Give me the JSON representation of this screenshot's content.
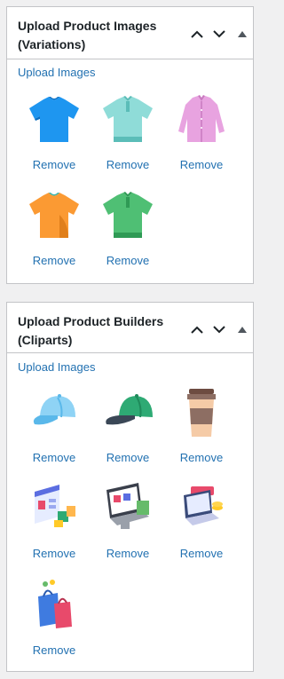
{
  "panels": [
    {
      "title": "Upload Product Images (Variations)",
      "upload_label": "Upload Images",
      "items": [
        {
          "icon": "blue-tshirt-icon",
          "remove_label": "Remove"
        },
        {
          "icon": "teal-polo-shirt-icon",
          "remove_label": "Remove"
        },
        {
          "icon": "pink-dress-shirt-icon",
          "remove_label": "Remove"
        },
        {
          "icon": "orange-tshirt-icon",
          "remove_label": "Remove"
        },
        {
          "icon": "green-polo-shirt-icon",
          "remove_label": "Remove"
        }
      ]
    },
    {
      "title": "Upload Product Builders (Cliparts)",
      "upload_label": "Upload Images",
      "items": [
        {
          "icon": "blue-cap-icon",
          "remove_label": "Remove"
        },
        {
          "icon": "green-cap-icon",
          "remove_label": "Remove"
        },
        {
          "icon": "coffee-cup-icon",
          "remove_label": "Remove"
        },
        {
          "icon": "online-store-isometric-icon",
          "remove_label": "Remove"
        },
        {
          "icon": "ecommerce-laptop-icon",
          "remove_label": "Remove"
        },
        {
          "icon": "online-payment-laptop-icon",
          "remove_label": "Remove"
        },
        {
          "icon": "shopping-bags-icon",
          "remove_label": "Remove"
        }
      ]
    }
  ],
  "colors": {
    "link": "#2271b1",
    "border": "#c3c4c7",
    "background": "#f0f0f1",
    "title": "#1d2327"
  }
}
